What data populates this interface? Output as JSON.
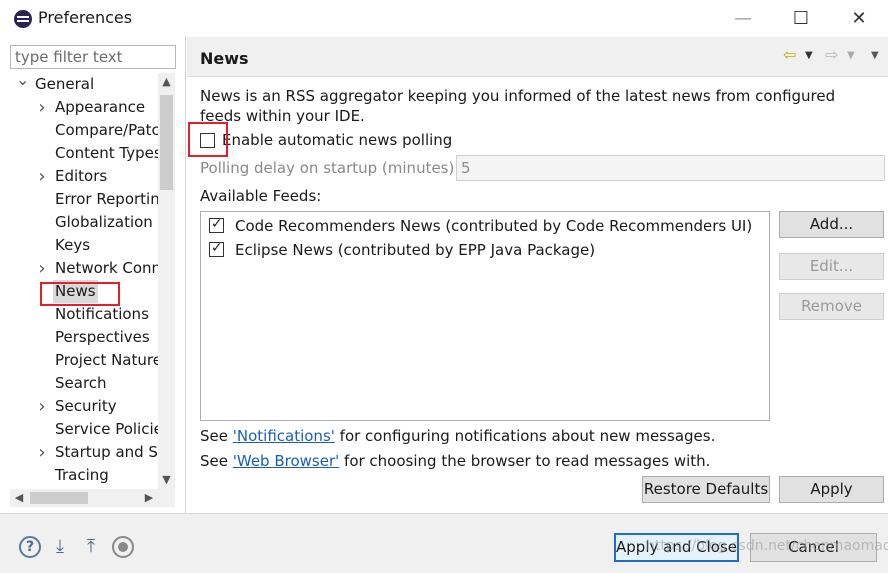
{
  "window": {
    "title": "Preferences",
    "app_icon": "eclipse-icon",
    "minimize_glyph": "—",
    "maximize_glyph": "☐",
    "close_glyph": "✕"
  },
  "sidebar": {
    "filter_placeholder": "type filter text",
    "tree": [
      {
        "label": "General",
        "arrow": "v",
        "level": 0
      },
      {
        "label": "Appearance",
        "arrow": ">",
        "level": 1
      },
      {
        "label": "Compare/Patch",
        "arrow": "",
        "level": 1
      },
      {
        "label": "Content Types",
        "arrow": "",
        "level": 1
      },
      {
        "label": "Editors",
        "arrow": ">",
        "level": 1
      },
      {
        "label": "Error Reporting",
        "arrow": "",
        "level": 1
      },
      {
        "label": "Globalization",
        "arrow": "",
        "level": 1
      },
      {
        "label": "Keys",
        "arrow": "",
        "level": 1
      },
      {
        "label": "Network Connections",
        "arrow": ">",
        "level": 1
      },
      {
        "label": "News",
        "arrow": "",
        "level": 1,
        "selected": true
      },
      {
        "label": "Notifications",
        "arrow": "",
        "level": 1
      },
      {
        "label": "Perspectives",
        "arrow": "",
        "level": 1
      },
      {
        "label": "Project Natures",
        "arrow": "",
        "level": 1
      },
      {
        "label": "Search",
        "arrow": "",
        "level": 1
      },
      {
        "label": "Security",
        "arrow": ">",
        "level": 1
      },
      {
        "label": "Service Policies",
        "arrow": "",
        "level": 1
      },
      {
        "label": "Startup and Shutdown",
        "arrow": ">",
        "level": 1
      },
      {
        "label": "Tracing",
        "arrow": "",
        "level": 1
      }
    ]
  },
  "page": {
    "title": "News",
    "description": "News is an RSS aggregator keeping you informed of the latest news from configured feeds within your IDE.",
    "auto_polling": {
      "label": "Enable automatic news polling",
      "checked": false
    },
    "delay": {
      "label": "Polling delay on startup (minutes):",
      "value": "5"
    },
    "feeds_label": "Available Feeds:",
    "feeds": [
      {
        "label": "Code Recommenders News (contributed by Code Recommenders UI)",
        "checked": true
      },
      {
        "label": "Eclipse News (contributed by EPP Java Package)",
        "checked": true
      }
    ],
    "buttons": {
      "add": "Add...",
      "edit": "Edit...",
      "remove": "Remove"
    },
    "see_notifications": {
      "prefix": "See ",
      "link": "'Notifications'",
      "suffix": " for configuring notifications about new messages."
    },
    "see_browser": {
      "prefix": "See ",
      "link": "'Web Browser'",
      "suffix": " for choosing the browser to read messages with."
    },
    "restore_defaults": "Restore Defaults",
    "apply": "Apply"
  },
  "footer": {
    "apply_and_close": "Apply and Close",
    "cancel": "Cancel",
    "watermark": "https://blog.csdn.net/chenmaomao"
  },
  "colors": {
    "highlight_border": "#e0202a",
    "link": "#1a5fb4",
    "default_button_border": "#1c6fc9"
  }
}
